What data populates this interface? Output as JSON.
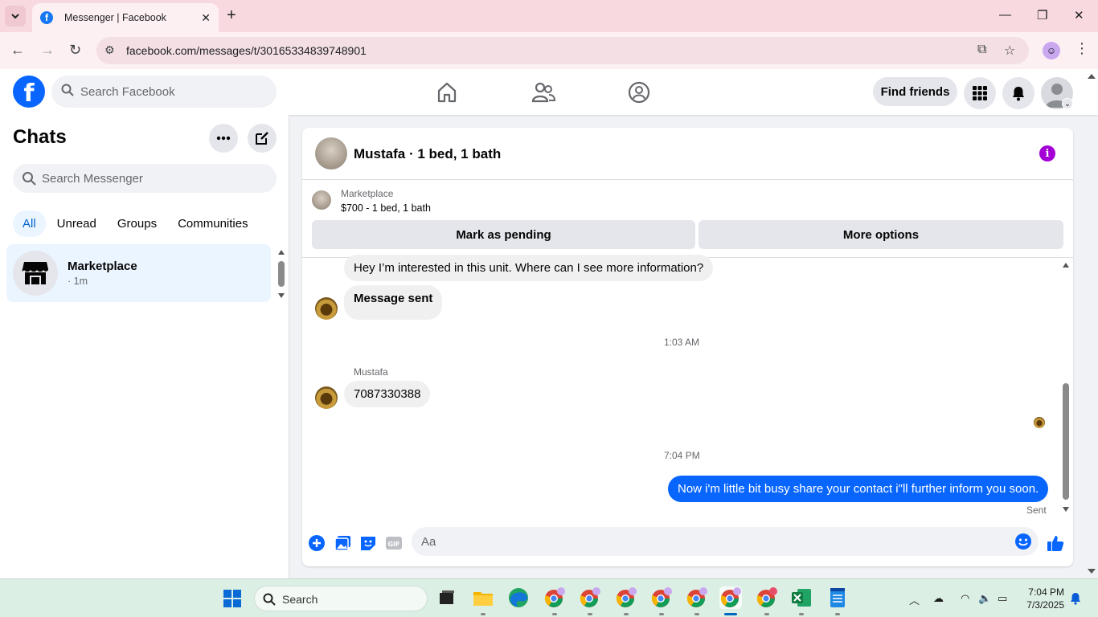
{
  "browser": {
    "tab_title": "Messenger | Facebook",
    "url": "facebook.com/messages/t/30165334839748901"
  },
  "header": {
    "search_placeholder": "Search Facebook",
    "find_friends": "Find friends"
  },
  "sidebar": {
    "title": "Chats",
    "search_placeholder": "Search Messenger",
    "filters": [
      "All",
      "Unread",
      "Groups",
      "Communities"
    ],
    "chats": [
      {
        "name": "Marketplace",
        "time": "· 1m"
      }
    ]
  },
  "conversation": {
    "title": "Mustafa · 1 bed, 1 bath",
    "marketplace_label": "Marketplace",
    "listing": "$700 - 1 bed, 1 bath",
    "mark_pending": "Mark as pending",
    "more_options": "More options",
    "messages": {
      "m1": "Hey I’m interested in this unit.  Where can I see more information?",
      "m2": "Message sent",
      "time1": "1:03 AM",
      "sender": "Mustafa",
      "m3": "7087330388",
      "time2": "7:04 PM",
      "m4": "Now i'm little bit busy share your contact i\"ll further inform you soon.",
      "status": "Sent"
    },
    "composer_placeholder": "Aa"
  },
  "taskbar": {
    "search_placeholder": "Search",
    "time": "7:04 PM",
    "date": "7/3/2025"
  },
  "colors": {
    "facebook_blue": "#0866ff",
    "active_filter_bg": "#ebf5ff",
    "info_purple": "#a400d6"
  }
}
